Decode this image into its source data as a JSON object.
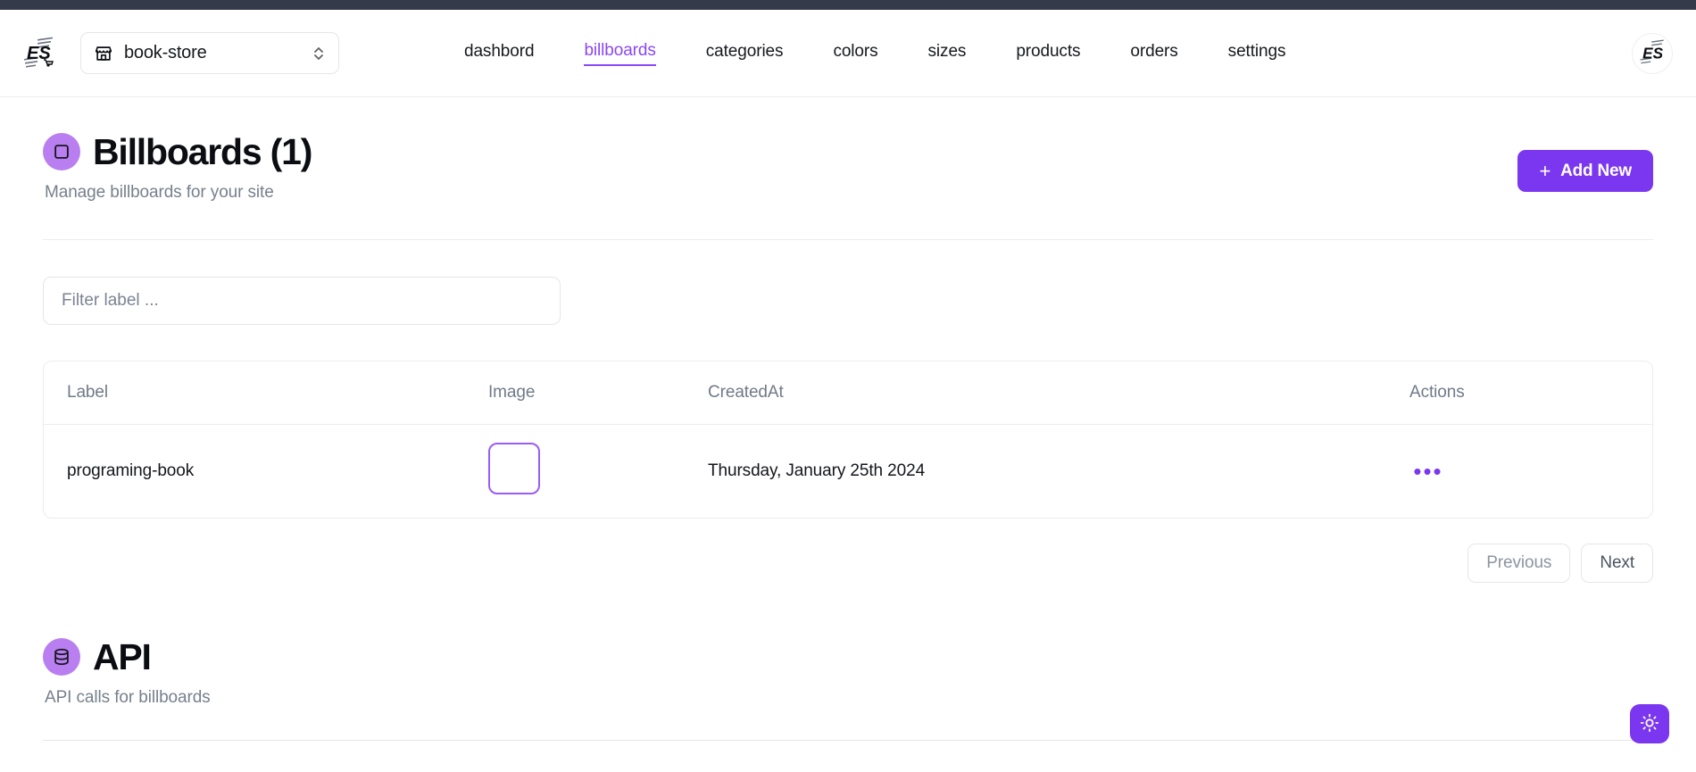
{
  "theme": {
    "accent": "#7b37ef",
    "accent_light": "#b97ef0",
    "topbar_color": "#343a4a",
    "muted_text": "#76808d"
  },
  "navbar": {
    "brand_logo_alt": "es-logo",
    "store_switcher": {
      "value": "book-store",
      "icon": "store-icon"
    },
    "links": [
      {
        "label": "dashbord",
        "active": false
      },
      {
        "label": "billboards",
        "active": true
      },
      {
        "label": "categories",
        "active": false
      },
      {
        "label": "colors",
        "active": false
      },
      {
        "label": "sizes",
        "active": false
      },
      {
        "label": "products",
        "active": false
      },
      {
        "label": "orders",
        "active": false
      },
      {
        "label": "settings",
        "active": false
      }
    ],
    "avatar_alt": "es-avatar"
  },
  "page_header": {
    "icon": "square-icon",
    "title": "Billboards (1)",
    "subtitle": "Manage billboards for your site",
    "add_button": {
      "plus": "+",
      "label": "Add New"
    }
  },
  "filter": {
    "value": "",
    "placeholder": "Filter label ..."
  },
  "table": {
    "columns": [
      "Label",
      "Image",
      "CreatedAt",
      "Actions"
    ],
    "rows": [
      {
        "label": "programing-book",
        "image_alt": "billboard-thumbnail",
        "created_at": "Thursday, January 25th 2024",
        "actions_glyph": "•••"
      }
    ]
  },
  "pagination": {
    "previous": "Previous",
    "next": "Next"
  },
  "api_section": {
    "icon": "database-icon",
    "title": "API",
    "subtitle": "API calls for billboards"
  },
  "theme_toggle": {
    "icon": "sun-icon"
  }
}
